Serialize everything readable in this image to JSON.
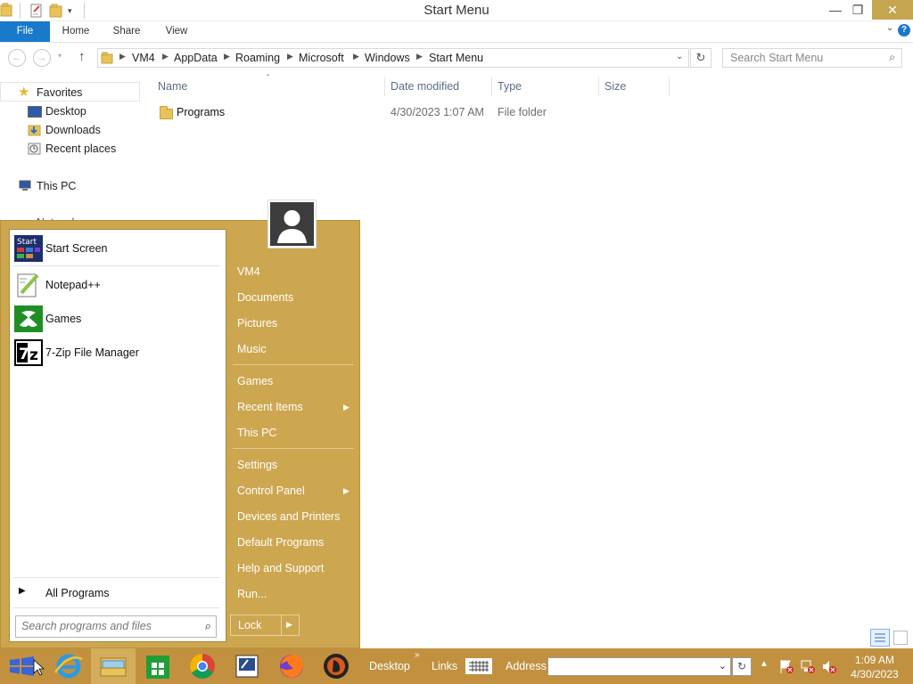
{
  "window": {
    "title": "Start Menu",
    "controls": {
      "minimize": "—",
      "restore": "❐",
      "close": "✕"
    }
  },
  "ribbon": {
    "tabs": [
      {
        "label": "File"
      },
      {
        "label": "Home"
      },
      {
        "label": "Share"
      },
      {
        "label": "View"
      }
    ],
    "help": "?"
  },
  "address": {
    "breadcrumb": [
      "VM4",
      "AppData",
      "Roaming",
      "Microsoft",
      "Windows",
      "Start Menu"
    ],
    "search_placeholder": "Search Start Menu"
  },
  "nav_pane": {
    "favorites_label": "Favorites",
    "items": [
      {
        "label": "Desktop"
      },
      {
        "label": "Downloads"
      },
      {
        "label": "Recent places"
      }
    ],
    "this_pc": "This PC",
    "network_partial": "Network"
  },
  "file_list": {
    "columns": {
      "name": "Name",
      "date": "Date modified",
      "type": "Type",
      "size": "Size"
    },
    "rows": [
      {
        "name": "Programs",
        "date": "4/30/2023 1:07 AM",
        "type": "File folder",
        "size": ""
      }
    ]
  },
  "start_menu": {
    "programs": [
      {
        "label": "Start Screen",
        "icon": "start-screen-icon"
      },
      {
        "label": "Notepad++",
        "icon": "notepadpp-icon"
      },
      {
        "label": "Games",
        "icon": "xbox-games-icon"
      },
      {
        "label": "7-Zip File Manager",
        "icon": "seven-zip-icon"
      }
    ],
    "all_programs": "All Programs",
    "search_placeholder": "Search programs and files",
    "right_items": [
      {
        "label": "VM4"
      },
      {
        "label": "Documents"
      },
      {
        "label": "Pictures"
      },
      {
        "label": "Music"
      },
      {
        "label": "Games"
      },
      {
        "label": "Recent Items"
      },
      {
        "label": "This PC"
      },
      {
        "label": "Settings"
      },
      {
        "label": "Control Panel"
      },
      {
        "label": "Devices and Printers"
      },
      {
        "label": "Default Programs"
      },
      {
        "label": "Help and Support"
      },
      {
        "label": "Run..."
      }
    ],
    "lock_label": "Lock"
  },
  "taskbar": {
    "desktop_label": "Desktop",
    "links_label": "Links",
    "address_label": "Address",
    "address_value": "",
    "time": "1:09 AM",
    "date": "4/30/2023"
  },
  "colors": {
    "accent_gold": "#cda650",
    "taskbar": "#c19140",
    "file_tab": "#1979ca"
  }
}
